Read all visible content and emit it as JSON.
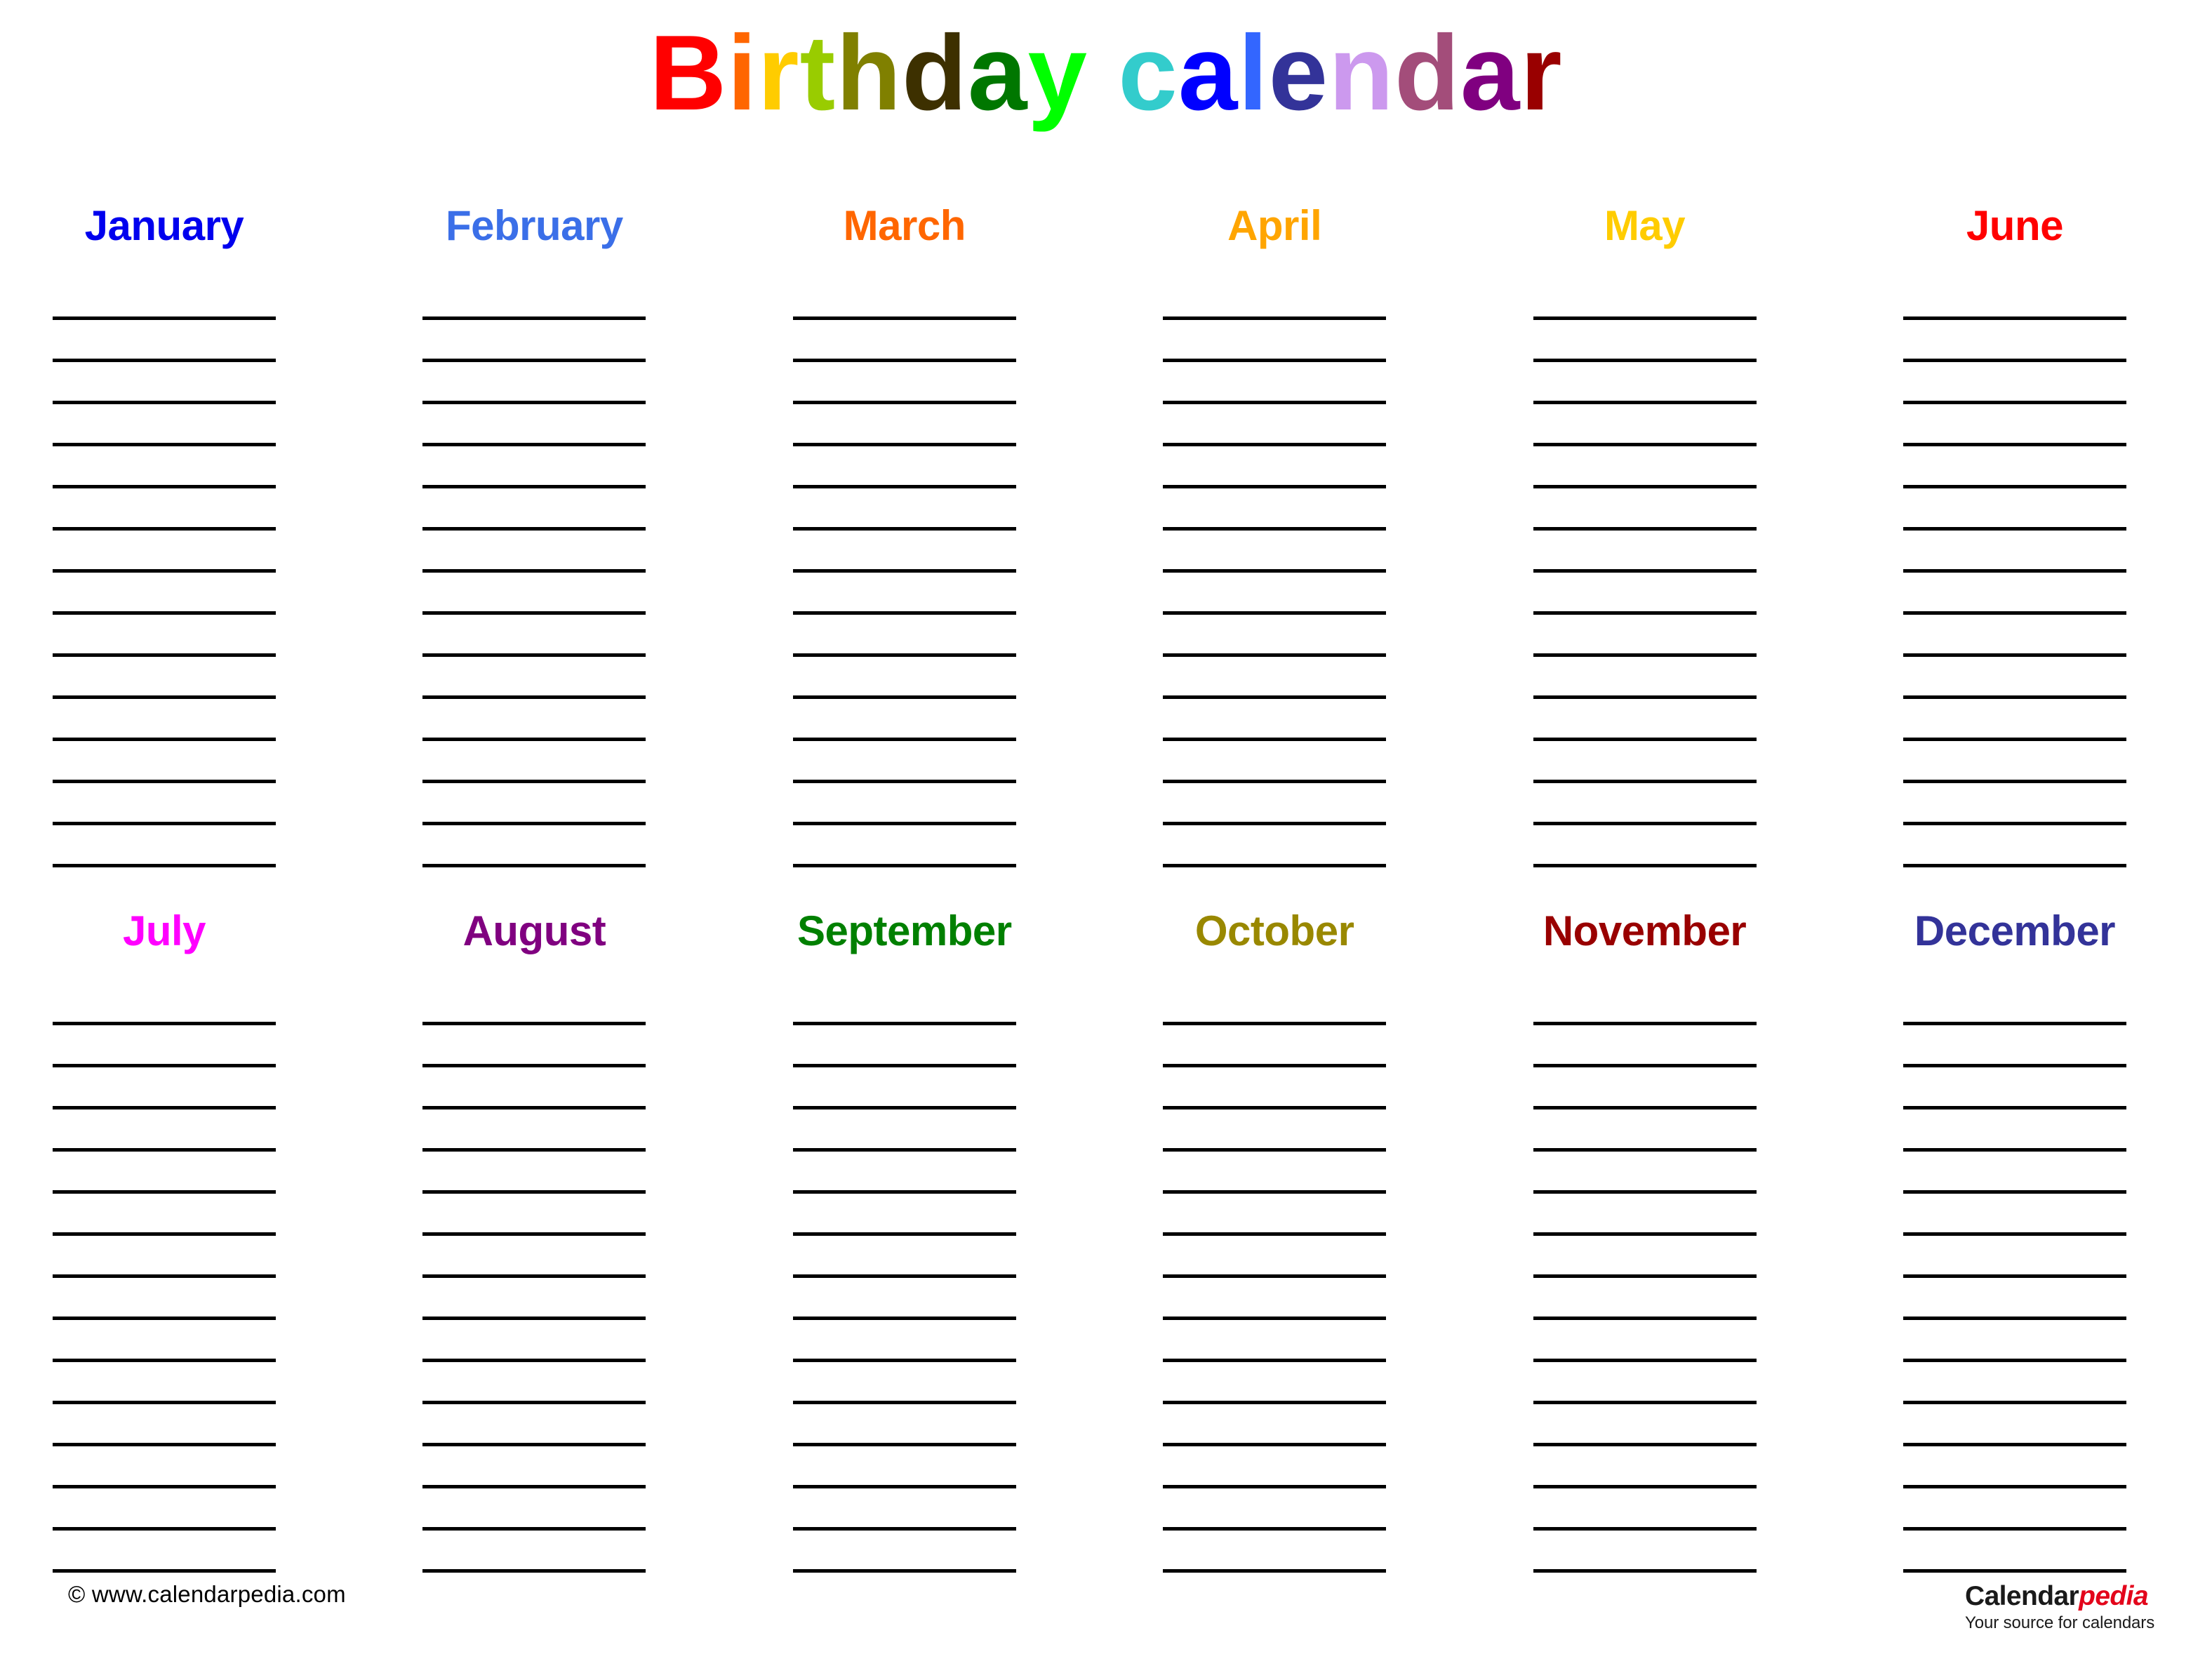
{
  "document": {
    "title": "Birthday calendar"
  },
  "title": {
    "text": "Birthday calendar",
    "letters": [
      {
        "char": "B",
        "color": "#ff0000"
      },
      {
        "char": "i",
        "color": "#ff6600"
      },
      {
        "char": "r",
        "color": "#ffcc00"
      },
      {
        "char": "t",
        "color": "#99cc00"
      },
      {
        "char": "h",
        "color": "#808000"
      },
      {
        "char": "d",
        "color": "#3d3000"
      },
      {
        "char": "a",
        "color": "#007700"
      },
      {
        "char": "y",
        "color": "#00ff00"
      },
      {
        "char": " ",
        "color": "#000000"
      },
      {
        "char": "c",
        "color": "#33cccc"
      },
      {
        "char": "a",
        "color": "#0000ff"
      },
      {
        "char": "l",
        "color": "#3366ff"
      },
      {
        "char": "e",
        "color": "#333399"
      },
      {
        "char": "n",
        "color": "#cc99ee"
      },
      {
        "char": "d",
        "color": "#a34d7a"
      },
      {
        "char": "a",
        "color": "#800080"
      },
      {
        "char": "r",
        "color": "#990000"
      }
    ]
  },
  "calendar": {
    "lines_per_month": 14,
    "rows": [
      {
        "months": [
          {
            "name": "January",
            "color": "#0000ee"
          },
          {
            "name": "February",
            "color": "#3b6fe8"
          },
          {
            "name": "March",
            "color": "#ff6600"
          },
          {
            "name": "April",
            "color": "#ffa500"
          },
          {
            "name": "May",
            "color": "#ffcc00"
          },
          {
            "name": "June",
            "color": "#ff0000"
          }
        ]
      },
      {
        "months": [
          {
            "name": "July",
            "color": "#ff00ff"
          },
          {
            "name": "August",
            "color": "#800080"
          },
          {
            "name": "September",
            "color": "#008000"
          },
          {
            "name": "October",
            "color": "#998800"
          },
          {
            "name": "November",
            "color": "#990000"
          },
          {
            "name": "December",
            "color": "#333399"
          }
        ]
      }
    ]
  },
  "footer": {
    "copyright": "© www.calendarpedia.com",
    "logo": {
      "name_black": "Calendar",
      "name_red": "pedia",
      "tagline": "Your source for calendars"
    }
  }
}
